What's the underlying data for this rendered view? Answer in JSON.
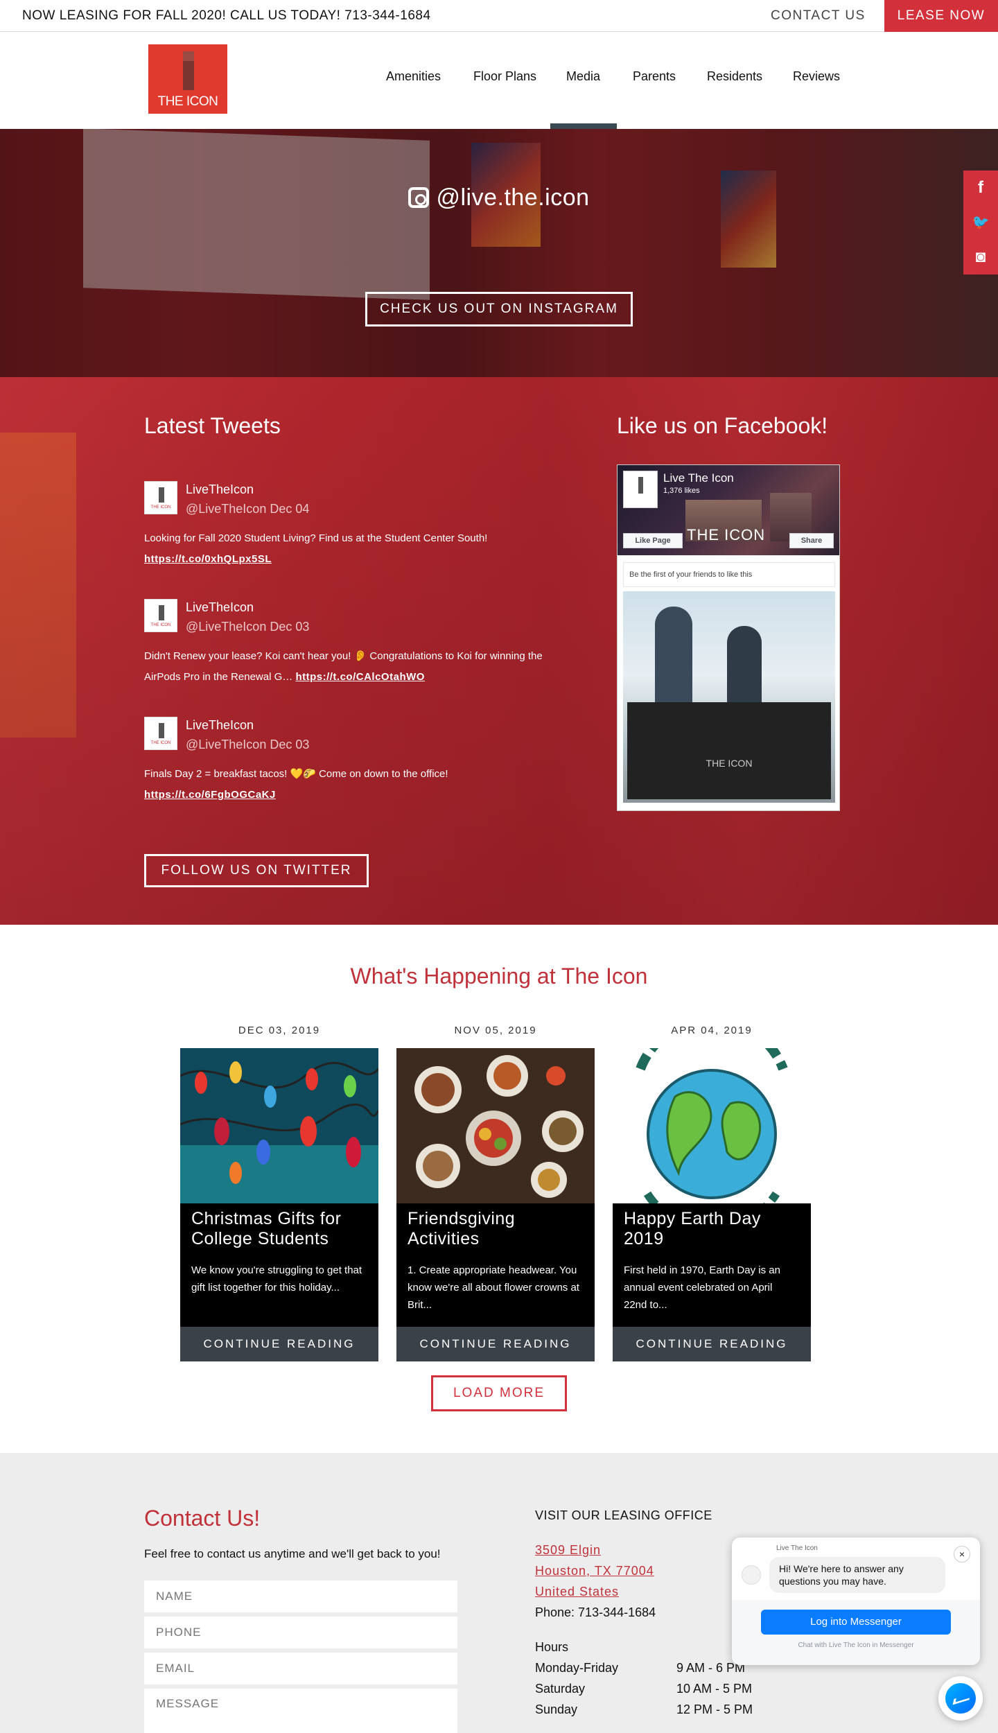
{
  "topbar": {
    "message": "NOW LEASING FOR FALL 2020! CALL US TODAY! 713-344-1684",
    "contact_label": "CONTACT US",
    "lease_label": "LEASE NOW"
  },
  "logo": {
    "text": "THE ICON"
  },
  "nav": {
    "items": [
      "Amenities",
      "Floor Plans",
      "Media",
      "Parents",
      "Residents",
      "Reviews"
    ],
    "active": "Media"
  },
  "instagram": {
    "handle": "@live.the.icon",
    "button_label": "CHECK US OUT ON INSTAGRAM",
    "icon": "instagram-icon"
  },
  "social": [
    {
      "icon": "facebook-icon",
      "glyph": "f"
    },
    {
      "icon": "twitter-icon",
      "glyph": "🐦"
    },
    {
      "icon": "instagram-icon",
      "glyph": "◙"
    }
  ],
  "tweets": {
    "heading": "Latest Tweets",
    "items": [
      {
        "name": "LiveTheIcon",
        "meta": "@LiveTheIcon Dec 04",
        "text": "Looking for Fall 2020 Student Living? Find us at the Student Center South!",
        "link": "https://t.co/0xhQLpx5SL"
      },
      {
        "name": "LiveTheIcon",
        "meta": "@LiveTheIcon Dec 03",
        "text": "Didn't Renew your lease? Koi can't hear you! 👂 Congratulations to Koi for winning the AirPods Pro in the Renewal G… ",
        "link": "https://t.co/CAlcOtahWO"
      },
      {
        "name": "LiveTheIcon",
        "meta": "@LiveTheIcon Dec 03",
        "text": "Finals Day 2 = breakfast tacos! 💛🌮 Come on down to the office!",
        "link": "https://t.co/6FgbOGCaKJ"
      }
    ],
    "follow_label": "FOLLOW US ON TWITTER"
  },
  "facebook": {
    "heading": "Like us on Facebook!",
    "page_name": "Live The Icon",
    "likes": "1,376 likes",
    "like_button": "Like Page",
    "share_button": "Share",
    "friends_text": "Be the first of your friends to like this",
    "cover_logo": "THE ICON",
    "photo_logo": "THE ICON"
  },
  "happening": {
    "heading": "What's Happening at The Icon",
    "posts": [
      {
        "date": "DEC 03, 2019",
        "title": "Christmas Gifts for College Students",
        "excerpt": "We know you're struggling to get that gift list together for this holiday...",
        "more": "CONTINUE READING"
      },
      {
        "date": "NOV 05, 2019",
        "title": "Friendsgiving Activities",
        "excerpt": "1. Create appropriate headwear. You know we're all about flower crowns at Brit...",
        "more": "CONTINUE READING"
      },
      {
        "date": "APR 04, 2019",
        "title": "Happy Earth Day 2019",
        "excerpt": "First held in 1970, Earth Day is an annual event celebrated on April 22nd to...",
        "more": "CONTINUE READING"
      }
    ],
    "load_more": "LOAD MORE"
  },
  "contact": {
    "heading": "Contact Us!",
    "subtext": "Feel free to contact us anytime and we'll get back to you!",
    "fields": {
      "name": "NAME",
      "phone": "PHONE",
      "email": "EMAIL",
      "message": "MESSAGE"
    },
    "office_heading": "VISIT OUR LEASING OFFICE",
    "address": [
      "3509 Elgin",
      "Houston, TX 77004",
      "United States"
    ],
    "phone": "Phone: 713-344-1684",
    "hours_heading": "Hours",
    "hours": [
      {
        "day": "Monday-Friday",
        "time": "9 AM - 6 PM"
      },
      {
        "day": "Saturday",
        "time": "10 AM - 5 PM"
      },
      {
        "day": "Sunday",
        "time": "12 PM - 5 PM"
      }
    ]
  },
  "messenger": {
    "from": "Live The Icon",
    "greeting": "Hi! We're here to answer any questions you may have.",
    "login_label": "Log into Messenger",
    "footer": "Chat with Live The Icon in Messenger",
    "close": "×"
  },
  "colors": {
    "brand_red": "#d2313c",
    "dark_slate": "#3b4148",
    "messenger_blue": "#0a7cff"
  }
}
